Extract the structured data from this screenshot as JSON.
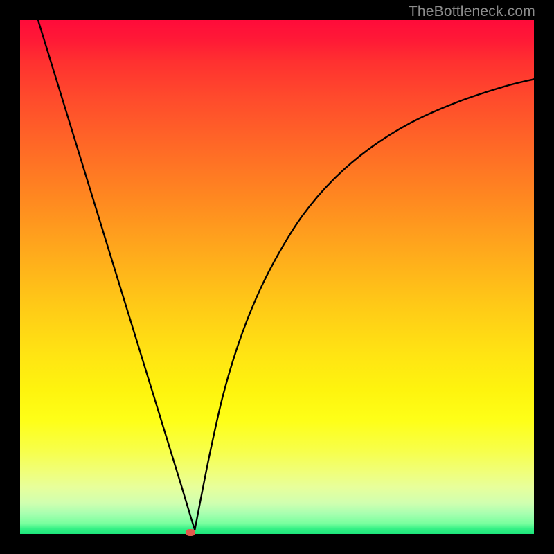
{
  "watermark": {
    "text": "TheBottleneck.com"
  },
  "chart_data": {
    "type": "line",
    "title": "",
    "xlabel": "",
    "ylabel": "",
    "xlim": [
      0,
      1
    ],
    "ylim": [
      0,
      1
    ],
    "series": [
      {
        "name": "left-branch",
        "x": [
          0.035,
          0.075,
          0.115,
          0.155,
          0.195,
          0.235,
          0.275,
          0.315,
          0.333,
          0.34
        ],
        "y": [
          1.0,
          0.87,
          0.74,
          0.61,
          0.48,
          0.35,
          0.22,
          0.09,
          0.03,
          0.008
        ]
      },
      {
        "name": "right-branch",
        "x": [
          0.34,
          0.35,
          0.37,
          0.395,
          0.425,
          0.46,
          0.5,
          0.55,
          0.61,
          0.68,
          0.76,
          0.85,
          0.94,
          1.0
        ],
        "y": [
          0.008,
          0.06,
          0.16,
          0.27,
          0.37,
          0.46,
          0.54,
          0.62,
          0.69,
          0.75,
          0.8,
          0.84,
          0.87,
          0.885
        ]
      }
    ],
    "marker": {
      "x": 0.332,
      "y": 0.003
    },
    "gradient_stops": [
      {
        "p": 0,
        "c": "#ff0b3a"
      },
      {
        "p": 50,
        "c": "#ffb81a"
      },
      {
        "p": 80,
        "c": "#fbff20"
      },
      {
        "p": 100,
        "c": "#1be47a"
      }
    ]
  }
}
